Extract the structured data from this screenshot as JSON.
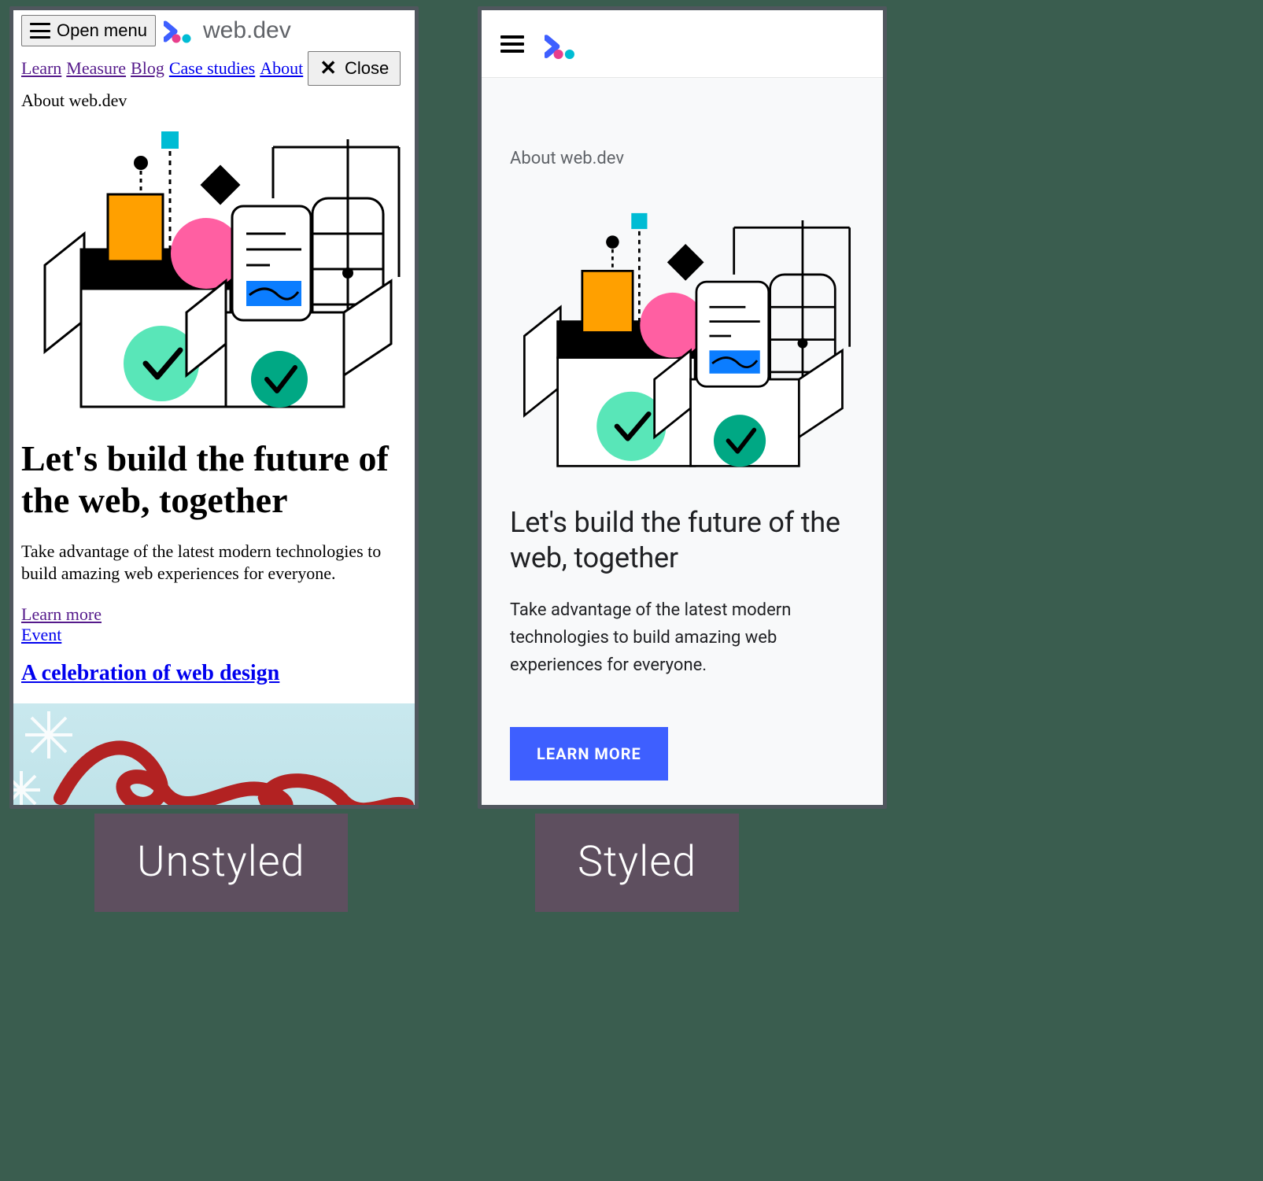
{
  "captions": {
    "left": "Unstyled",
    "right": "Styled"
  },
  "left": {
    "open_menu": "Open menu",
    "brand": "web.dev",
    "nav": {
      "learn": "Learn",
      "measure": "Measure",
      "blog": "Blog",
      "case_studies": "Case studies",
      "about": "About"
    },
    "close": "Close",
    "eyebrow": "About web.dev",
    "h1": "Let's build the future of the web, together",
    "p": "Take advantage of the latest modern technologies to build amazing web experiences for everyone.",
    "learn_more": "Learn more",
    "event_label": "Event",
    "event_title": "A celebration of web design"
  },
  "right": {
    "eyebrow": "About web.dev",
    "h1": "Let's build the future of the web, together",
    "p": "Take advantage of the latest modern technologies to build amazing web experiences for everyone.",
    "learn_more": "LEARN MORE"
  }
}
